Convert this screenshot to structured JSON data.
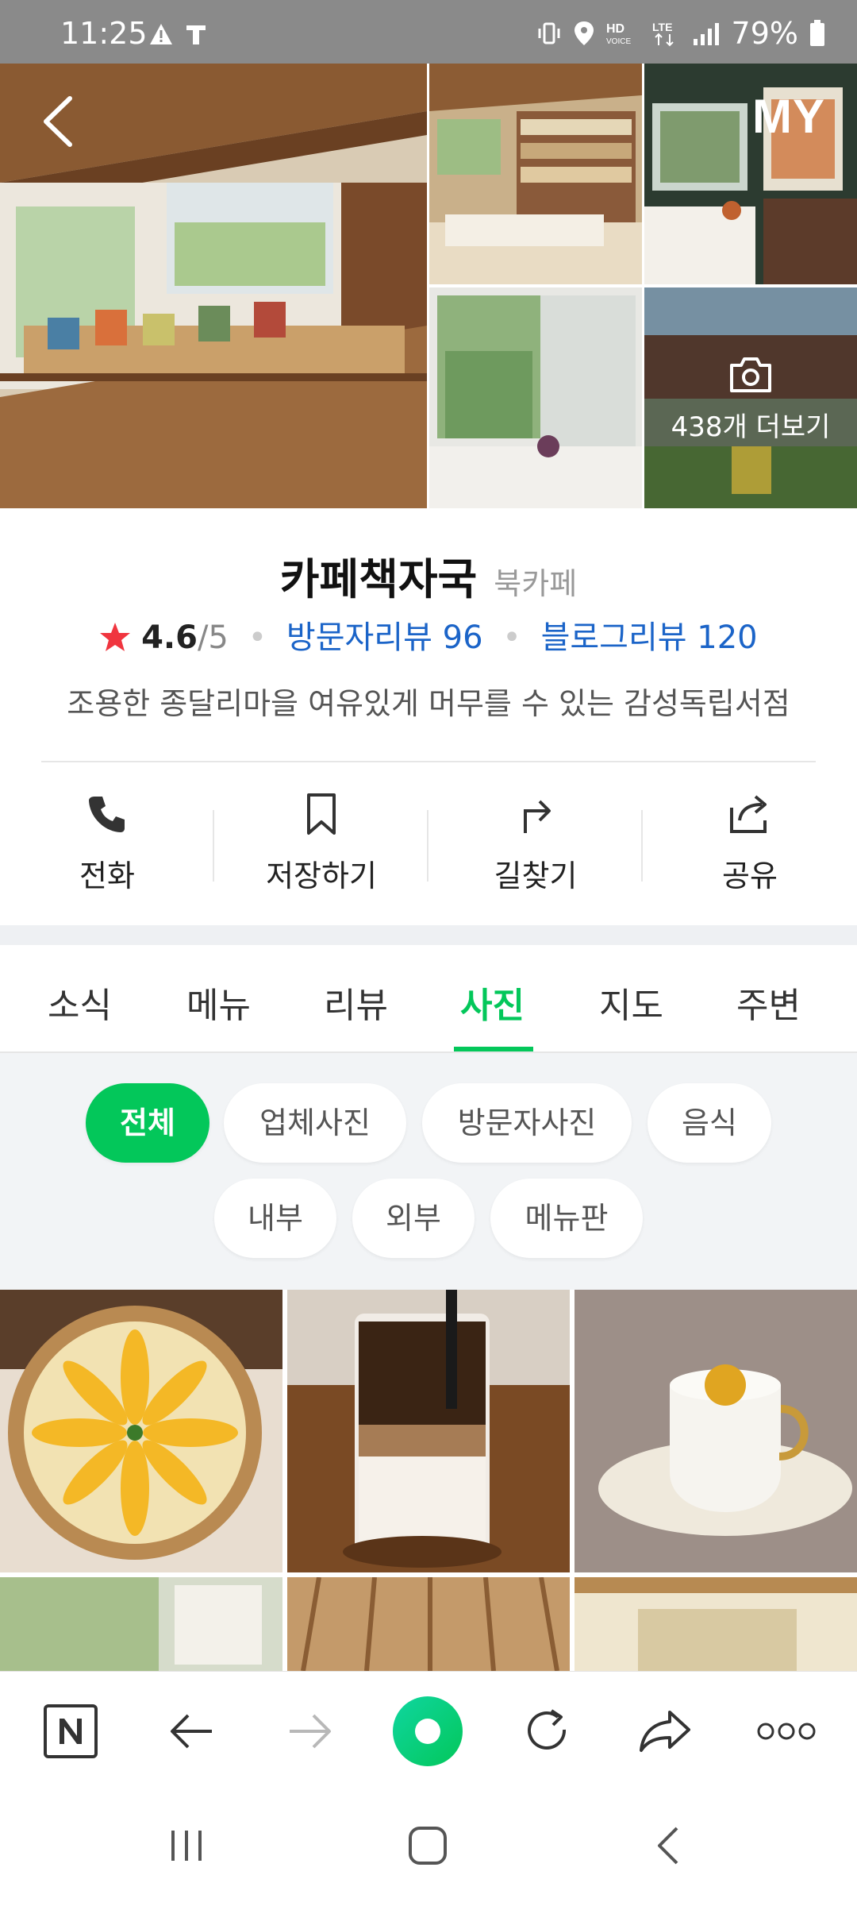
{
  "status_bar": {
    "time": "11:25",
    "battery": "79%"
  },
  "header": {
    "back_label": "back",
    "my_label": "MY"
  },
  "gallery": {
    "more_label": "438개 더보기"
  },
  "place": {
    "name": "카페책자국",
    "category": "북카페",
    "rating": "4.6",
    "rating_max": "/5",
    "visitor_reviews": "방문자리뷰 96",
    "blog_reviews": "블로그리뷰 120",
    "description": "조용한 종달리마을 여유있게 머무를 수 있는 감성독립서점"
  },
  "actions": [
    {
      "label": "전화",
      "icon": "phone-icon"
    },
    {
      "label": "저장하기",
      "icon": "bookmark-icon"
    },
    {
      "label": "길찾기",
      "icon": "directions-icon"
    },
    {
      "label": "공유",
      "icon": "share-icon"
    }
  ],
  "tabs": [
    "소식",
    "메뉴",
    "리뷰",
    "사진",
    "지도",
    "주변"
  ],
  "active_tab": "사진",
  "chips": [
    "전체",
    "업체사진",
    "방문자사진",
    "음식",
    "내부",
    "외부",
    "메뉴판"
  ],
  "active_chip": "전체",
  "colors": {
    "accent": "#03c75a",
    "link": "#1b64c8",
    "star": "#f0353f"
  }
}
